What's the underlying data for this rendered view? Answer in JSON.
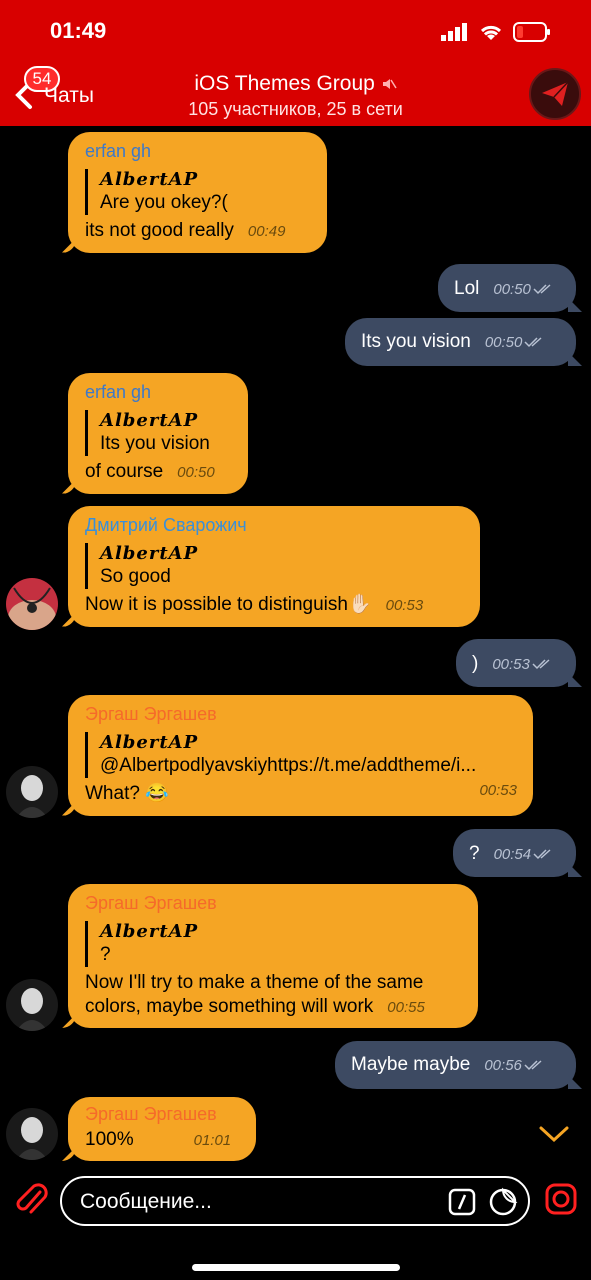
{
  "status": {
    "time": "01:49"
  },
  "header": {
    "badge": "54",
    "back_label": "Чаты",
    "title": "iOS Themes Group",
    "subtitle": "105 участников, 25 в сети"
  },
  "messages": [
    {
      "sender": "erfan gh",
      "reply_to": "AlbertAP",
      "quote": "Are you okey?(",
      "text": "its not good really",
      "time": "00:49"
    },
    {
      "text": "Lol",
      "time": "00:50"
    },
    {
      "text": "Its you vision",
      "time": "00:50"
    },
    {
      "sender": "erfan gh",
      "reply_to": "AlbertAP",
      "quote": "Its you vision",
      "text": "of course",
      "time": "00:50"
    },
    {
      "sender": "Дмитрий Сварожич",
      "reply_to": "AlbertAP",
      "quote": "So good",
      "text": "Now it is possible to distinguish✋🏻",
      "time": "00:53"
    },
    {
      "text": ")",
      "time": "00:53"
    },
    {
      "sender": "Эргаш Эргашев",
      "reply_to": "AlbertAP",
      "quote": "@Albertpodlyavskiyhttps://t.me/addtheme/i...",
      "text": "What? 😂",
      "time": "00:53"
    },
    {
      "text": "?",
      "time": "00:54"
    },
    {
      "sender": "Эргаш Эргашев",
      "reply_to": "AlbertAP",
      "quote": "?",
      "text": "Now I'll try to make a theme of the same colors, maybe something will work",
      "time": "00:55"
    },
    {
      "text": "Maybe maybe",
      "time": "00:56"
    },
    {
      "sender": "Эргаш Эргашев",
      "text": "100%",
      "time": "01:01"
    }
  ],
  "composer": {
    "placeholder": "Сообщение..."
  },
  "colors": {
    "header": "#d80000",
    "incoming": "#f5a524",
    "outgoing": "#3d4a62",
    "erfan": "#3d79c9",
    "dmitry": "#3a8fd8",
    "ergash": "#f56a2a"
  }
}
